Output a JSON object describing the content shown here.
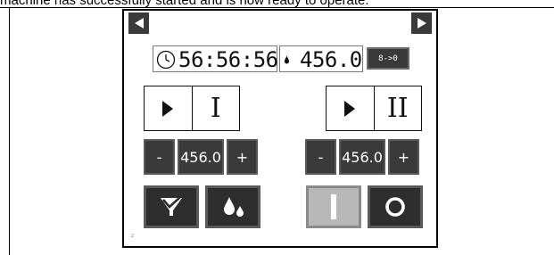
{
  "caption": "machine has successfully started and is now ready to operate.",
  "status": {
    "timer": "56:56:56",
    "count": "456.0",
    "reset_label": "8->0"
  },
  "run_buttons": [
    {
      "label": "I"
    },
    {
      "label": "II"
    }
  ],
  "steppers": [
    {
      "minus": "-",
      "value": "456.0",
      "plus": "+"
    },
    {
      "minus": "-",
      "value": "456.0",
      "plus": "+"
    }
  ],
  "corner_marker": "z",
  "colors": {
    "button_dark": "#3a3a3a",
    "button_active": "#b8b8b8",
    "panel_border": "#000000"
  },
  "icons": {
    "nav_left": "triangle-left-icon",
    "nav_right": "triangle-right-icon",
    "timer": "clock-icon",
    "count": "drop-icon",
    "run": "play-icon",
    "action_1": "funnel-check-icon",
    "action_2": "droplets-icon",
    "action_3": "on-icon",
    "action_4": "off-icon"
  }
}
